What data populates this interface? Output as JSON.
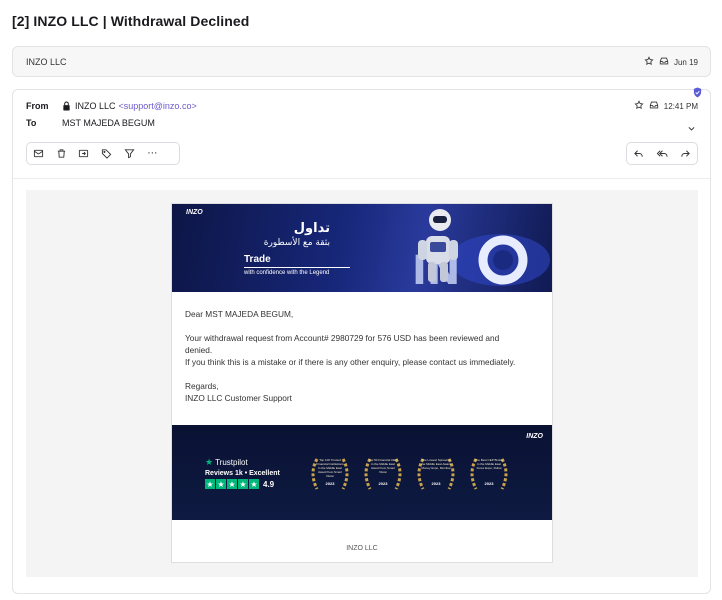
{
  "subject": "[2] INZO LLC | Withdrawal Declined",
  "collapsed": {
    "sender": "INZO LLC",
    "date": "Jun 19"
  },
  "header": {
    "from_label": "From",
    "from_name": "INZO LLC",
    "from_email": "<support@inzo.co>",
    "to_label": "To",
    "to_name": "MST MAJEDA BEGUM",
    "time": "12:41 PM"
  },
  "toolbar": {
    "left": [
      "envelope-icon",
      "trash-icon",
      "move-icon",
      "tag-icon",
      "filter-icon",
      "more-icon"
    ],
    "right": [
      "reply-icon",
      "reply-all-icon",
      "forward-icon"
    ],
    "more_label": "⋯"
  },
  "banner": {
    "logo": "INZO",
    "arabic_title": "تداول",
    "arabic_sub": "بثقة مع الأسطورة",
    "trade": "Trade",
    "confidence": "with confidence with the Legend"
  },
  "message": {
    "greeting": "Dear MST MAJEDA BEGUM,",
    "line1": "Your withdrawal request from Account# 2980729 for 576 USD has been reviewed and",
    "line2": "denied.",
    "line3": "If you think this is a mistake or if there is any other enquiry, please contact us immediately.",
    "regards": "Regards,",
    "signature": "INZO LLC Customer Support"
  },
  "footer_banner": {
    "logo": "INZO",
    "trustpilot": "Trustpilot",
    "reviews": "Reviews 1k • Excellent",
    "score": "4.9",
    "stars": 5,
    "awards": [
      {
        "text": "Top 100 Trusted Financial Institutions in the Middle East Award from Smart Vision",
        "year": "2023"
      },
      {
        "text": "Top 50 Financial CEO in the Middle East Award from Smart Vision",
        "year": "2023"
      },
      {
        "text": "The Lowest Spread in the Middle East Award Money Expo, Mumbai",
        "year": "2023"
      },
      {
        "text": "The Best CEP Broker in the Middle East Forex Expo, Dubai",
        "year": "2023"
      }
    ]
  },
  "mail_footer": "INZO LLC",
  "colors": {
    "link": "#6a5acd",
    "banner": "#17277a",
    "trustpilot": "#00b67a",
    "shield": "#5b5bd6"
  }
}
